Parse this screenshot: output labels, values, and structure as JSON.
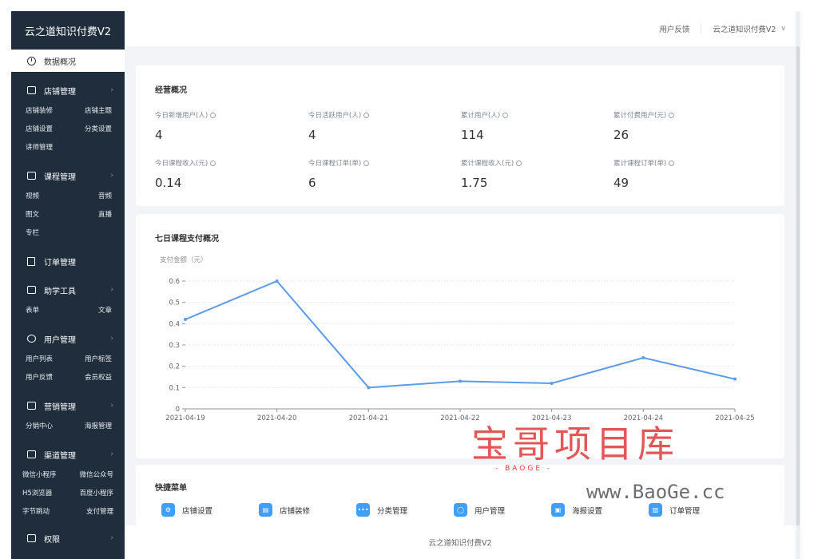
{
  "sidebar": {
    "brand": "云之道知识付费V2",
    "active": "数据概况",
    "groups": [
      {
        "label": "店铺管理",
        "items": [
          "店铺装修",
          "店铺主题",
          "店铺设置",
          "分类设置",
          "讲师管理"
        ]
      },
      {
        "label": "课程管理",
        "items": [
          "视频",
          "音频",
          "图文",
          "直播",
          "专栏"
        ]
      },
      {
        "label": "订单管理",
        "items": []
      },
      {
        "label": "助学工具",
        "items": [
          "表单",
          "文章"
        ]
      },
      {
        "label": "用户管理",
        "items": [
          "用户列表",
          "用户标签",
          "用户反馈",
          "会员权益"
        ]
      },
      {
        "label": "营销管理",
        "items": [
          "分销中心",
          "海报管理"
        ]
      },
      {
        "label": "渠道管理",
        "items": [
          "微信小程序",
          "微信公众号",
          "H5浏览器",
          "百度小程序",
          "字节跳动",
          "支付管理"
        ]
      },
      {
        "label": "权限",
        "items": []
      }
    ]
  },
  "header": {
    "feedback": "用户反馈",
    "account": "云之道知识付费V2"
  },
  "overview": {
    "title": "经营概况",
    "stats": [
      {
        "label": "今日新增用户(人)",
        "value": "4"
      },
      {
        "label": "今日活跃用户(人)",
        "value": "4"
      },
      {
        "label": "累计用户(人)",
        "value": "114"
      },
      {
        "label": "累计付费用户(元)",
        "value": "26"
      },
      {
        "label": "今日课程收入(元)",
        "value": "0.14"
      },
      {
        "label": "今日课程订单(单)",
        "value": "6"
      },
      {
        "label": "累计课程收入(元)",
        "value": "1.75"
      },
      {
        "label": "累计课程订单(单)",
        "value": "49"
      }
    ]
  },
  "chart_data": {
    "type": "line",
    "title": "七日课程支付概况",
    "ylabel": "支付金额（元）",
    "x": [
      "2021-04-19",
      "2021-04-20",
      "2021-04-21",
      "2021-04-22",
      "2021-04-23",
      "2021-04-24",
      "2021-04-25"
    ],
    "series": [
      {
        "values": [
          0.42,
          0.6,
          0.1,
          0.13,
          0.12,
          0.24,
          0.14
        ]
      }
    ],
    "ylim": [
      0,
      0.6
    ],
    "yticks": [
      "0",
      "0.1",
      "0.2",
      "0.3",
      "0.4",
      "0.5",
      "0.6"
    ],
    "grid": true,
    "color": "#5b9bea"
  },
  "quick_menu": {
    "title": "快捷菜单",
    "items": [
      {
        "label": "店铺设置",
        "icon": "gear-icon"
      },
      {
        "label": "店铺装修",
        "icon": "brush-icon"
      },
      {
        "label": "分类管理",
        "icon": "dots-icon"
      },
      {
        "label": "用户管理",
        "icon": "user-icon"
      },
      {
        "label": "海报设置",
        "icon": "image-icon"
      },
      {
        "label": "订单管理",
        "icon": "document-icon"
      }
    ]
  },
  "footer": {
    "text": "云之道知识付费V2"
  },
  "watermark": {
    "brand": "宝哥项目库",
    "sub": "- BAOGE -",
    "url": "www.BaoGe.cc"
  }
}
